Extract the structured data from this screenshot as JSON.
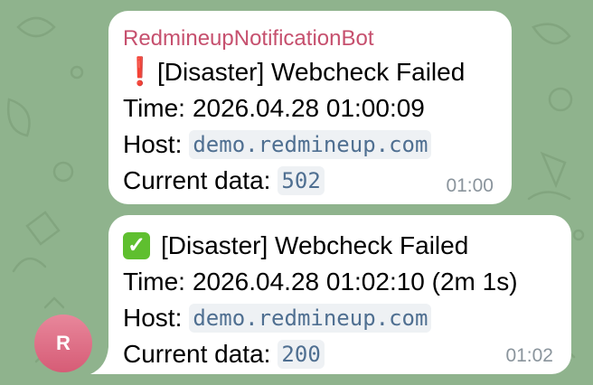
{
  "messages": [
    {
      "sender": "RedmineupNotificationBot",
      "status_icon": "red-exclamation-icon",
      "status_glyph": "❗",
      "title": "[Disaster] Webcheck Failed",
      "time_label": "Time:",
      "time_value": "2026.04.28 01:00:09",
      "host_label": "Host:",
      "host_value": "demo.redmineup.com",
      "data_label": "Current data:",
      "data_value": "502",
      "sent_at": "01:00"
    },
    {
      "status_icon": "green-check-icon",
      "status_glyph": "✓",
      "title": "[Disaster] Webcheck Failed",
      "time_label": "Time:",
      "time_value": "2026.04.28 01:02:10 (2m 1s)",
      "host_label": "Host:",
      "host_value": "demo.redmineup.com",
      "data_label": "Current data:",
      "data_value": "200",
      "sent_at": "01:02"
    }
  ],
  "avatar": {
    "initial": "R",
    "color": "#d65c76"
  },
  "colors": {
    "wallpaper": "#8fb38d",
    "sender_name": "#c6506e",
    "code_text": "#4f6f91"
  }
}
